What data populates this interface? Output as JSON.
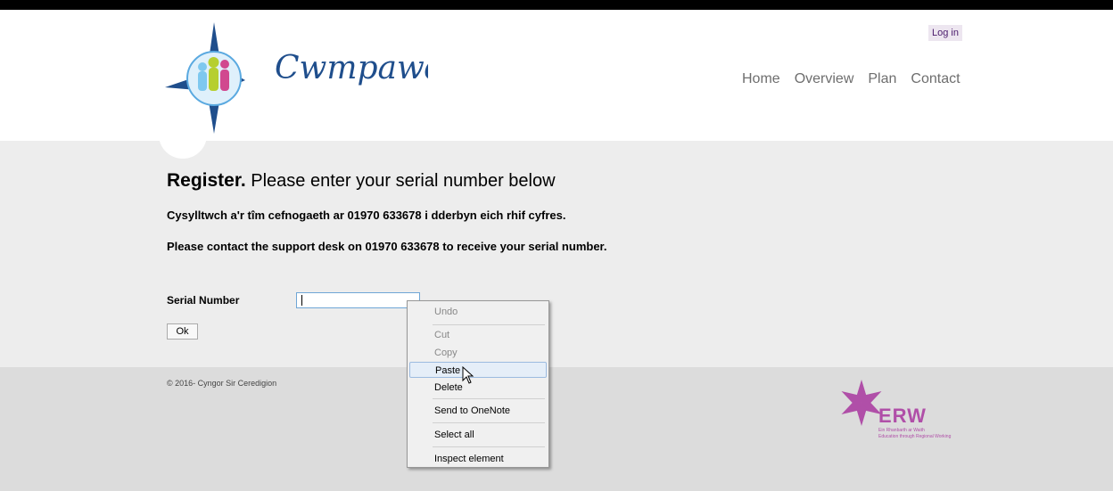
{
  "header": {
    "logo_text": "Cwmpawd",
    "login_label": "Log in",
    "nav": [
      "Home",
      "Overview",
      "Plan",
      "Contact"
    ]
  },
  "main": {
    "title_bold": "Register.",
    "title_rest": " Please enter your serial number below",
    "line_welsh": "Cysylltwch a'r tîm cefnogaeth ar 01970 633678 i dderbyn eich rhif cyfres.",
    "line_english": "Please contact the support desk on 01970 633678 to receive your serial number.",
    "serial_label": "Serial Number",
    "serial_value": "",
    "ok_label": "Ok"
  },
  "footer": {
    "copyright": "© 2016- Cyngor Sir Ceredigion",
    "erw_logo": "ERW",
    "erw_line1": "Ein Rhanbarth ar Waith",
    "erw_line2": "Education through Regional Working"
  },
  "context_menu": {
    "items": [
      {
        "label": "Undo",
        "disabled": true
      },
      {
        "label": "Cut",
        "disabled": true
      },
      {
        "label": "Copy",
        "disabled": true
      },
      {
        "label": "Paste",
        "disabled": false,
        "hover": true
      },
      {
        "label": "Delete",
        "disabled": false
      },
      {
        "label": "Send to OneNote",
        "disabled": false
      },
      {
        "label": "Select all",
        "disabled": false
      },
      {
        "label": "Inspect element",
        "disabled": false
      }
    ]
  },
  "colors": {
    "brand_blue": "#1f4e8c",
    "accent_purple": "#b04fa8",
    "main_bg": "#ededed",
    "footer_bg": "#dcdcdc"
  }
}
